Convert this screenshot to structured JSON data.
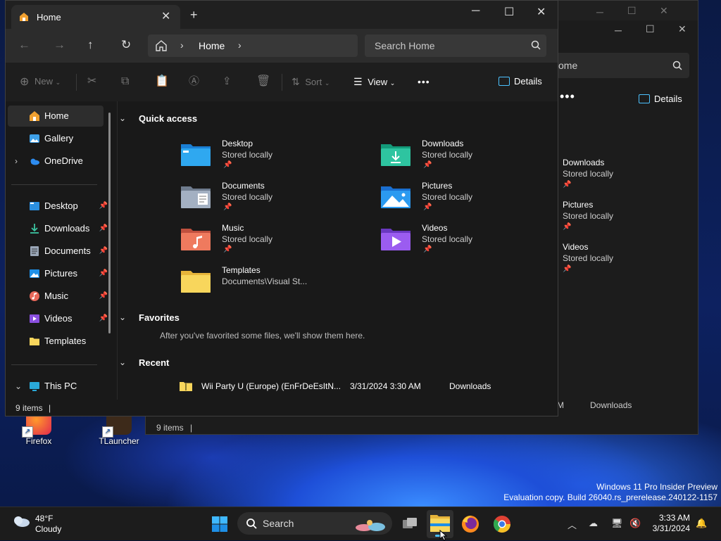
{
  "desktop": {
    "icons": [
      {
        "label": "Firefox"
      },
      {
        "label": "TLauncher"
      }
    ],
    "watermark_line1": "Windows 11 Pro Insider Preview",
    "watermark_line2": "Evaluation copy. Build 26040.rs_prerelease.240122-1157"
  },
  "back_window": {
    "search_text": "ome",
    "details_label": "Details",
    "items": [
      {
        "name": "Downloads",
        "sub": "Stored locally"
      },
      {
        "name": "Pictures",
        "sub": "Stored locally"
      },
      {
        "name": "Videos",
        "sub": "Stored locally"
      }
    ],
    "recent_time_fragment": "M",
    "recent_location": "Downloads",
    "status": "9 items"
  },
  "window": {
    "tab_title": "Home",
    "close_tab": "✕",
    "new_tab": "+",
    "controls": {
      "minimize": "─",
      "maximize": "☐",
      "close": "✕"
    },
    "address": {
      "crumb": "Home"
    },
    "search": {
      "placeholder": "Search Home"
    },
    "toolbar": {
      "new_label": "New",
      "sort_label": "Sort",
      "view_label": "View",
      "more_label": "•••",
      "details_label": "Details"
    },
    "sidebar": {
      "top": [
        {
          "label": "Home"
        },
        {
          "label": "Gallery"
        },
        {
          "label": "OneDrive"
        }
      ],
      "pinned": [
        {
          "label": "Desktop"
        },
        {
          "label": "Downloads"
        },
        {
          "label": "Documents"
        },
        {
          "label": "Pictures"
        },
        {
          "label": "Music"
        },
        {
          "label": "Videos"
        },
        {
          "label": "Templates"
        }
      ],
      "this_pc": "This PC"
    },
    "sections": {
      "quick_access": "Quick access",
      "favorites": "Favorites",
      "recent": "Recent"
    },
    "quick_access": [
      {
        "name": "Desktop",
        "sub": "Stored locally"
      },
      {
        "name": "Downloads",
        "sub": "Stored locally"
      },
      {
        "name": "Documents",
        "sub": "Stored locally"
      },
      {
        "name": "Pictures",
        "sub": "Stored locally"
      },
      {
        "name": "Music",
        "sub": "Stored locally"
      },
      {
        "name": "Videos",
        "sub": "Stored locally"
      },
      {
        "name": "Templates",
        "sub": "Documents\\Visual St..."
      }
    ],
    "favorites_message": "After you've favorited some files, we'll show them here.",
    "recent": [
      {
        "name": "Wii Party U (Europe) (EnFrDeEsItN...",
        "date": "3/31/2024 3:30 AM",
        "location": "Downloads"
      }
    ],
    "status": "9 items"
  },
  "taskbar": {
    "weather_temp": "48°F",
    "weather_cond": "Cloudy",
    "search_label": "Search",
    "time": "3:33 AM",
    "date": "3/31/2024"
  },
  "colors": {
    "accent": "#4cc2ff",
    "window_bg": "#191919",
    "folder_yellow": "#f8d65c"
  }
}
